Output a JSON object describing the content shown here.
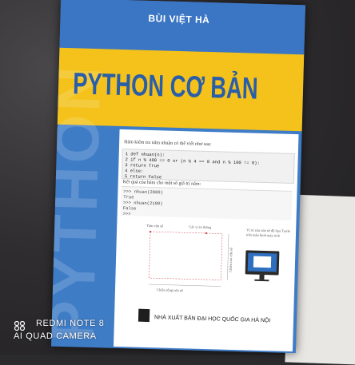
{
  "book": {
    "author": "BÙI VIỆT HÀ",
    "title": "PYTHON CƠ BẢN",
    "spine_watermark": "PYTHON",
    "intro_text": "Hàm kiểm tra năm nhuận có thể viết như sau:",
    "code_lines": [
      "1  def nhuan(n):",
      "2      if n % 400 == 0 or (n % 4 == 0 and n % 100 != 0):",
      "3          return True",
      "4      else:",
      "5          return False"
    ],
    "result_text": "Kết quả của hàm cho một số giá trị năm:",
    "repl_lines": [
      ">>> nhuan(2000)",
      "True",
      ">>> nhuan(2100)",
      "False",
      ">>>"
    ],
    "diagram": {
      "label_top_left": "Tâm cửa sổ",
      "label_top_mid": "Các vị trí thông",
      "label_right": "Vị trí của cửa sổ đồ họa Turtle trên màn hình máy tính",
      "label_side": "Chiều cao cửa sổ",
      "label_bottom": "Chiều rộng cửa sổ"
    },
    "publisher": "NHÀ XUẤT BẢN ĐẠI HỌC QUỐC GIA HÀ NỘI"
  },
  "camera_watermark": {
    "line1": "REDMI NOTE 8",
    "line2": "AI QUAD CAMERA"
  },
  "colors": {
    "cover_blue": "#3f7cc6",
    "band_yellow": "#f4c21a",
    "title_blue": "#2a5ea8"
  }
}
